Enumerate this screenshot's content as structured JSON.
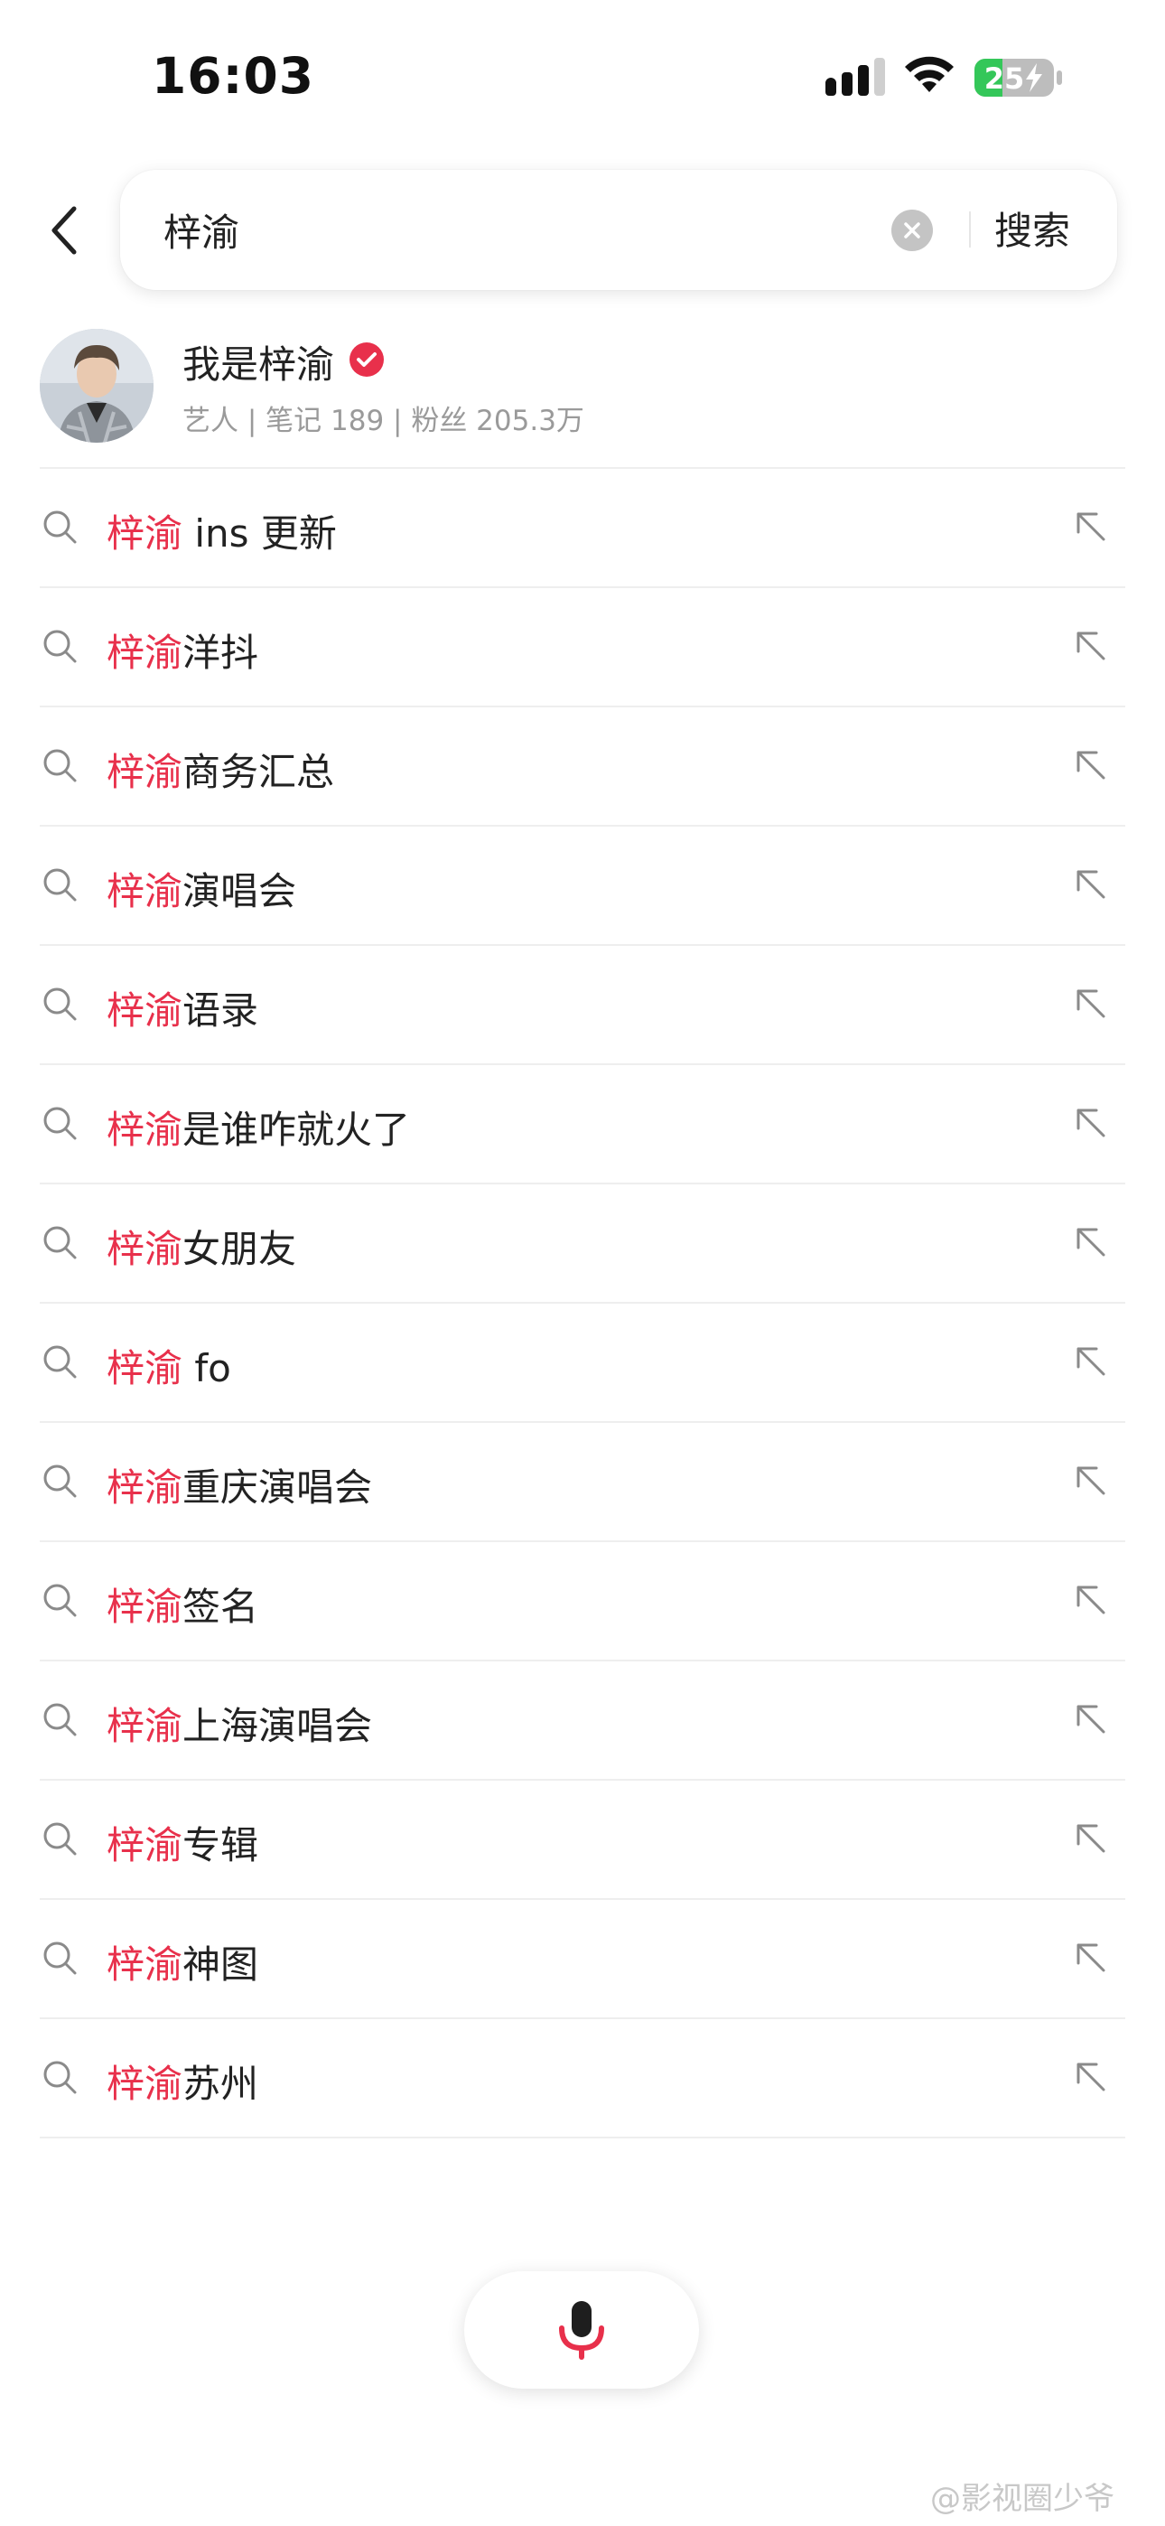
{
  "status_bar": {
    "time": "16:03",
    "battery_level": "25"
  },
  "search": {
    "query": "梓渝",
    "submit_label": "搜索"
  },
  "user": {
    "name": "我是梓渝",
    "meta": "艺人 | 笔记 189 | 粉丝 205.3万"
  },
  "suggestions": [
    {
      "highlight": "梓渝",
      "rest": " ins 更新"
    },
    {
      "highlight": "梓渝",
      "rest": "洋抖"
    },
    {
      "highlight": "梓渝",
      "rest": "商务汇总"
    },
    {
      "highlight": "梓渝",
      "rest": "演唱会"
    },
    {
      "highlight": "梓渝",
      "rest": "语录"
    },
    {
      "highlight": "梓渝",
      "rest": "是谁咋就火了"
    },
    {
      "highlight": "梓渝",
      "rest": "女朋友"
    },
    {
      "highlight": "梓渝",
      "rest": " fo"
    },
    {
      "highlight": "梓渝",
      "rest": "重庆演唱会"
    },
    {
      "highlight": "梓渝",
      "rest": "签名"
    },
    {
      "highlight": "梓渝",
      "rest": "上海演唱会"
    },
    {
      "highlight": "梓渝",
      "rest": "专辑"
    },
    {
      "highlight": "梓渝",
      "rest": "神图"
    },
    {
      "highlight": "梓渝",
      "rest": "苏州"
    }
  ],
  "watermark": "@影视圈少爷",
  "colors": {
    "accent": "#e8304b",
    "battery": "#34c759"
  }
}
